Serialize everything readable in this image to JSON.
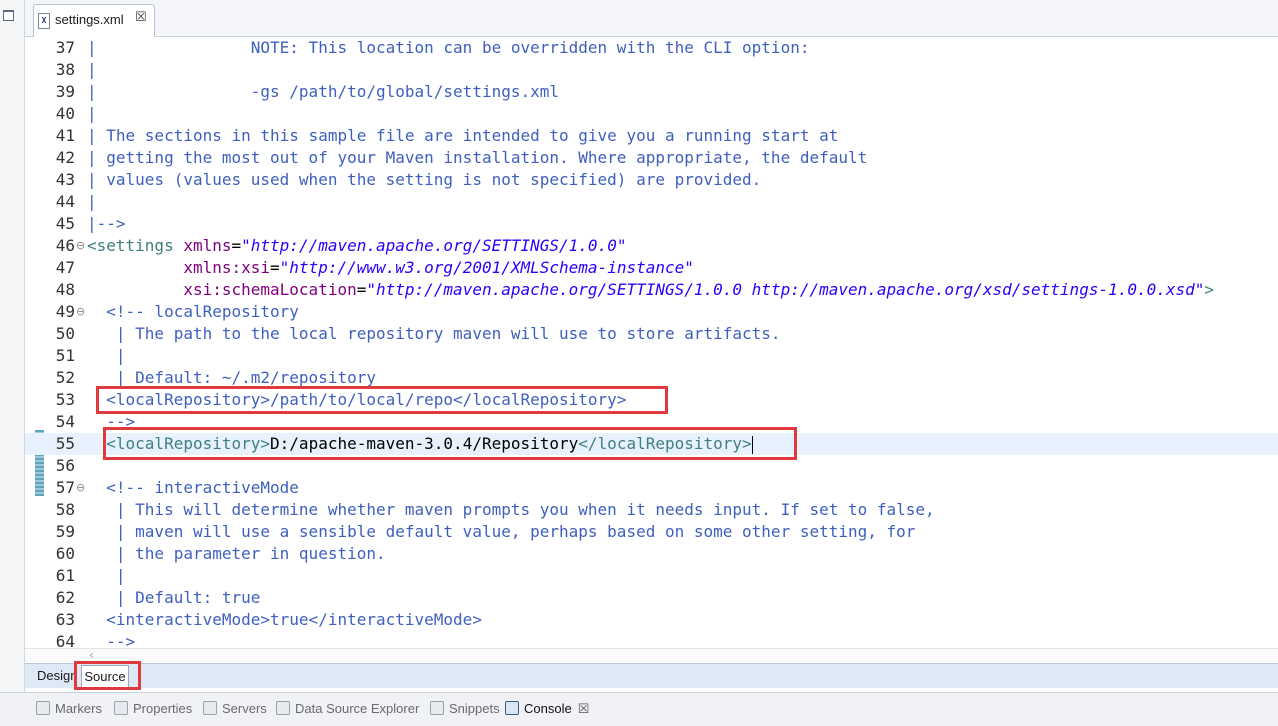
{
  "editor_tab": {
    "label": "settings.xml",
    "icon": "xml-file-icon",
    "close": "☒"
  },
  "lines": [
    {
      "n": "37",
      "fold": "",
      "segs": [
        {
          "c": "c",
          "t": "|                NOTE: This location can be overridden with the CLI option:"
        }
      ]
    },
    {
      "n": "38",
      "fold": "",
      "segs": [
        {
          "c": "c",
          "t": "|"
        }
      ]
    },
    {
      "n": "39",
      "fold": "",
      "segs": [
        {
          "c": "c",
          "t": "|                -gs /path/to/global/settings.xml"
        }
      ]
    },
    {
      "n": "40",
      "fold": "",
      "segs": [
        {
          "c": "c",
          "t": "|"
        }
      ]
    },
    {
      "n": "41",
      "fold": "",
      "segs": [
        {
          "c": "c",
          "t": "| The sections in this sample file are intended to give you a running start at"
        }
      ]
    },
    {
      "n": "42",
      "fold": "",
      "segs": [
        {
          "c": "c",
          "t": "| getting the most out of your Maven installation. Where appropriate, the default"
        }
      ]
    },
    {
      "n": "43",
      "fold": "",
      "segs": [
        {
          "c": "c",
          "t": "| values (values used when the setting is not specified) are provided."
        }
      ]
    },
    {
      "n": "44",
      "fold": "",
      "segs": [
        {
          "c": "c",
          "t": "|"
        }
      ]
    },
    {
      "n": "45",
      "fold": "",
      "segs": [
        {
          "c": "c",
          "t": "|-->"
        }
      ]
    },
    {
      "n": "46",
      "fold": "⊖",
      "segs": [
        {
          "c": "t",
          "t": "<settings "
        },
        {
          "c": "a",
          "t": "xmlns"
        },
        {
          "c": "txt",
          "t": "="
        },
        {
          "c": "v",
          "t": "\"http://maven.apache.org/SETTINGS/1.0.0\""
        }
      ]
    },
    {
      "n": "47",
      "fold": "",
      "segs": [
        {
          "c": "txt",
          "t": "          "
        },
        {
          "c": "a",
          "t": "xmlns:xsi"
        },
        {
          "c": "txt",
          "t": "="
        },
        {
          "c": "v",
          "t": "\"http://www.w3.org/2001/XMLSchema-instance\""
        }
      ]
    },
    {
      "n": "48",
      "fold": "",
      "segs": [
        {
          "c": "txt",
          "t": "          "
        },
        {
          "c": "a",
          "t": "xsi:schemaLocation"
        },
        {
          "c": "txt",
          "t": "="
        },
        {
          "c": "v",
          "t": "\"http://maven.apache.org/SETTINGS/1.0.0 http://maven.apache.org/xsd/settings-1.0.0.xsd\""
        },
        {
          "c": "t",
          "t": ">"
        }
      ]
    },
    {
      "n": "49",
      "fold": "⊖",
      "segs": [
        {
          "c": "c",
          "t": "  <!-- localRepository"
        }
      ]
    },
    {
      "n": "50",
      "fold": "",
      "segs": [
        {
          "c": "c",
          "t": "   | The path to the local repository maven will use to store artifacts."
        }
      ]
    },
    {
      "n": "51",
      "fold": "",
      "segs": [
        {
          "c": "c",
          "t": "   |"
        }
      ]
    },
    {
      "n": "52",
      "fold": "",
      "segs": [
        {
          "c": "c",
          "t": "   | Default: ~/.m2/repository"
        }
      ]
    },
    {
      "n": "53",
      "fold": "",
      "segs": [
        {
          "c": "c",
          "t": "  <localRepository>/path/to/local/repo</localRepository>"
        }
      ]
    },
    {
      "n": "54",
      "fold": "",
      "segs": [
        {
          "c": "c",
          "t": "  -->"
        }
      ]
    },
    {
      "n": "55",
      "fold": "",
      "current": true,
      "segs": [
        {
          "c": "txt",
          "t": "  "
        },
        {
          "c": "t",
          "t": "<localRepository>"
        },
        {
          "c": "txt",
          "t": "D:/apache-maven-3.0.4/Repository"
        },
        {
          "c": "t",
          "t": "</localRepository>"
        }
      ]
    },
    {
      "n": "56",
      "fold": "",
      "segs": [
        {
          "c": "txt",
          "t": ""
        }
      ]
    },
    {
      "n": "57",
      "fold": "⊖",
      "segs": [
        {
          "c": "c",
          "t": "  <!-- interactiveMode"
        }
      ]
    },
    {
      "n": "58",
      "fold": "",
      "segs": [
        {
          "c": "c",
          "t": "   | This will determine whether maven prompts you when it needs input. If set to false,"
        }
      ]
    },
    {
      "n": "59",
      "fold": "",
      "segs": [
        {
          "c": "c",
          "t": "   | maven will use a sensible default value, perhaps based on some other setting, for"
        }
      ]
    },
    {
      "n": "60",
      "fold": "",
      "segs": [
        {
          "c": "c",
          "t": "   | the parameter in question."
        }
      ]
    },
    {
      "n": "61",
      "fold": "",
      "segs": [
        {
          "c": "c",
          "t": "   |"
        }
      ]
    },
    {
      "n": "62",
      "fold": "",
      "segs": [
        {
          "c": "c",
          "t": "   | Default: true"
        }
      ]
    },
    {
      "n": "63",
      "fold": "",
      "segs": [
        {
          "c": "c",
          "t": "  <interactiveMode>true</interactiveMode>"
        }
      ]
    },
    {
      "n": "64",
      "fold": "",
      "segs": [
        {
          "c": "c",
          "t": "  -->"
        }
      ]
    }
  ],
  "hscroll_arrow": "‹",
  "mode_tabs": {
    "design": "Design",
    "source": "Source"
  },
  "views": [
    {
      "label": "Markers",
      "icon": "markers-icon"
    },
    {
      "label": "Properties",
      "icon": "properties-icon"
    },
    {
      "label": "Servers",
      "icon": "servers-icon"
    },
    {
      "label": "Data Source Explorer",
      "icon": "data-source-explorer-icon"
    },
    {
      "label": "Snippets",
      "icon": "snippets-icon"
    },
    {
      "label": "Console",
      "icon": "console-icon",
      "active": true,
      "close": "☒"
    }
  ],
  "colors": {
    "comment": "#3f5fbf",
    "tag": "#3f7f7f",
    "attr": "#7f007f",
    "value": "#2a00ff",
    "highlight_box": "#e0393e"
  }
}
